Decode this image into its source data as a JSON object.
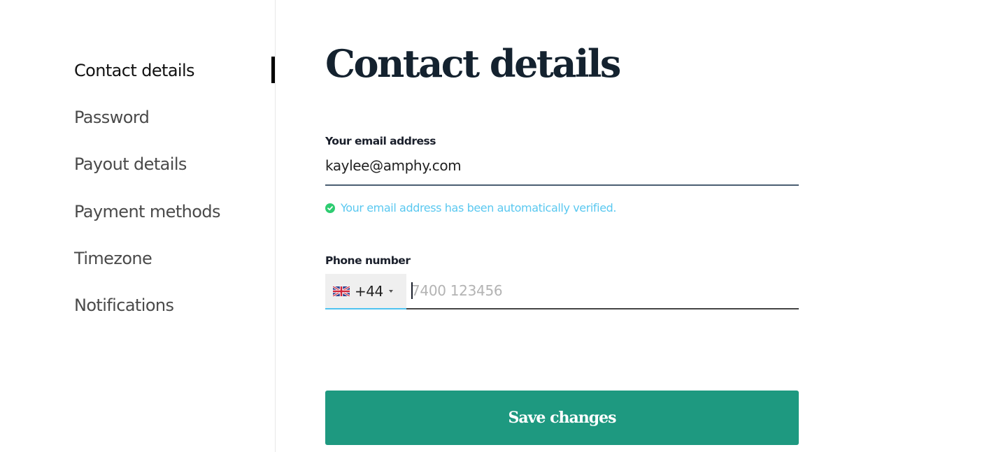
{
  "sidebar": {
    "active_index": 0,
    "items": [
      {
        "label": "Contact details"
      },
      {
        "label": "Password"
      },
      {
        "label": "Payout details"
      },
      {
        "label": "Payment methods"
      },
      {
        "label": "Timezone"
      },
      {
        "label": "Notifications"
      }
    ]
  },
  "main": {
    "title": "Contact details",
    "email": {
      "label": "Your email address",
      "value": "kaylee@amphy.com",
      "verified_message": "Your email address has been automatically verified.",
      "verified_icon": "check-circle-icon"
    },
    "phone": {
      "label": "Phone number",
      "country_flag": "uk-flag-icon",
      "dial_code": "+44",
      "value": "",
      "placeholder": "7400 123456"
    },
    "save_label": "Save changes"
  },
  "colors": {
    "accent_button": "#1e9980",
    "verified_text": "#5ac8f0",
    "verified_icon": "#2ecc71",
    "title": "#14222f",
    "focus_underline": "#4fc3f0"
  }
}
